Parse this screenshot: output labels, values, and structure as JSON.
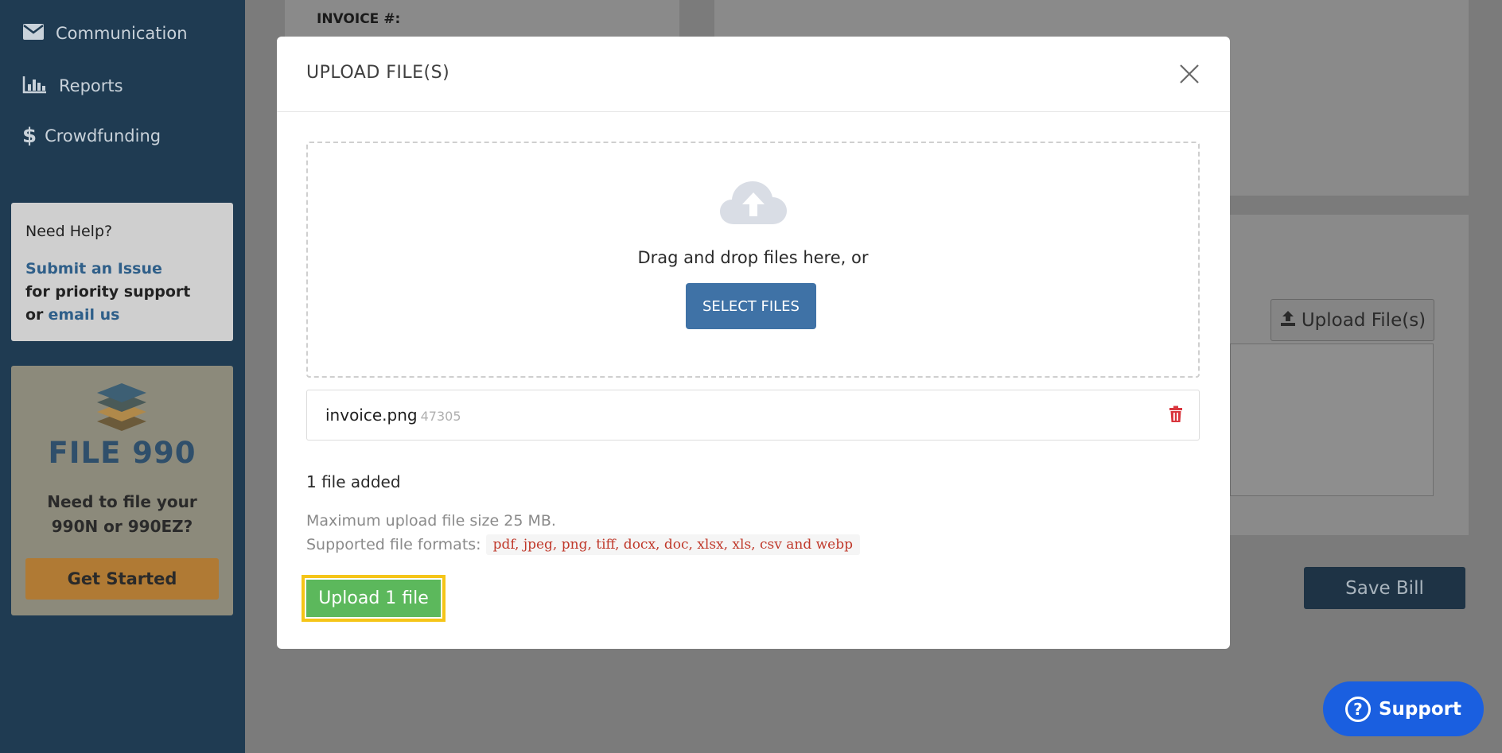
{
  "sidebar": {
    "nav": [
      {
        "label": "Communication",
        "icon": "envelope-icon"
      },
      {
        "label": "Reports",
        "icon": "bar-chart-icon"
      },
      {
        "label": "Crowdfunding",
        "icon": "dollar-icon"
      }
    ],
    "help": {
      "title": "Need Help?",
      "submit_link": "Submit an Issue",
      "priority_text": "for priority support",
      "or_text": "or",
      "email_link": "email us"
    },
    "promo": {
      "title": "FILE 990",
      "line1": "Need to file your",
      "line2": "990N or 990EZ?",
      "button": "Get Started"
    }
  },
  "background": {
    "invoice_label": "INVOICE #:",
    "upload_button": "Upload File(s)",
    "save_button": "Save Bill",
    "support_button": "Support"
  },
  "modal": {
    "title": "UPLOAD FILE(S)",
    "drop_text": "Drag and drop files here, or",
    "select_button": "SELECT FILES",
    "file": {
      "name": "invoice.png",
      "size": "47305"
    },
    "files_added": "1 file added",
    "max_size": "Maximum upload file size 25 MB.",
    "formats_label": "Supported file formats:",
    "formats": "pdf, jpeg, png, tiff, docx, doc, xlsx, xls, csv and webp",
    "upload_button": "Upload 1 file"
  },
  "colors": {
    "sidebar": "#1f3b52",
    "primary": "#3f72a6",
    "success": "#5cb85c",
    "highlight": "#f5c518",
    "danger": "#c0392b"
  }
}
